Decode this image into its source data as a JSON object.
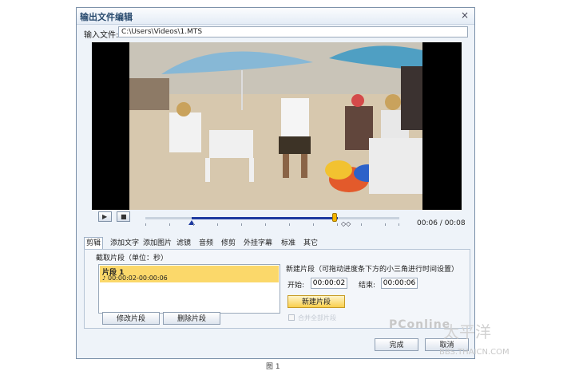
{
  "window": {
    "title": "输出文件编辑",
    "close_glyph": "×"
  },
  "input": {
    "label": "输入文件:",
    "value": "C:\\Users\\Videos\\1.MTS"
  },
  "player": {
    "play_icon": "play-icon",
    "stop_icon": "stop-icon",
    "time": "00:06 / 00:08",
    "progress_fraction": 0.75,
    "selection_start_fraction": 0.25,
    "selection_end_fraction": 0.75
  },
  "tabs": [
    "剪辑",
    "添加文字",
    "添加图片",
    "滤镜",
    "音频",
    "修剪",
    "外挂字幕",
    "标准",
    "其它"
  ],
  "clip_panel": {
    "group_label": "截取片段（单位：秒）",
    "segments": [
      {
        "name": "片段 1",
        "range": "00:00:02-00:00:06"
      }
    ],
    "modify_button": "修改片段",
    "delete_button": "删除片段",
    "new_segment_desc": "新建片段（可拖动进度条下方的小三角进行时间设置）",
    "start_label": "开始:",
    "start_value": "00:00:02",
    "end_label": "结束:",
    "end_value": "00:00:06",
    "new_segment_button": "新建片段",
    "checkbox_label": "合并全部片段"
  },
  "footer": {
    "done_button": "完成",
    "cancel_button": "取消"
  },
  "watermark": {
    "brand": "PConline",
    "text": "太平洋",
    "url": "BBS.THAICN.COM"
  },
  "caption": "图 1"
}
